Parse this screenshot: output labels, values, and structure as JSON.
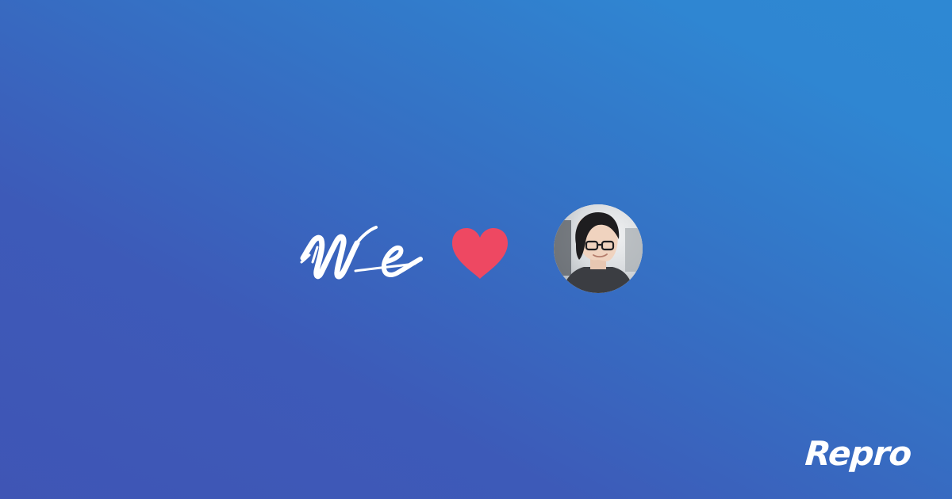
{
  "graphic": {
    "script_word": "We",
    "heart_icon": "heart-icon",
    "avatar_icon": "person-photo",
    "brand_logo_text": "Repro"
  },
  "colors": {
    "background_start": "#3f55b5",
    "background_end": "#2e88d3",
    "heart": "#ee4862",
    "script": "#ffffff",
    "logo": "#ffffff"
  }
}
